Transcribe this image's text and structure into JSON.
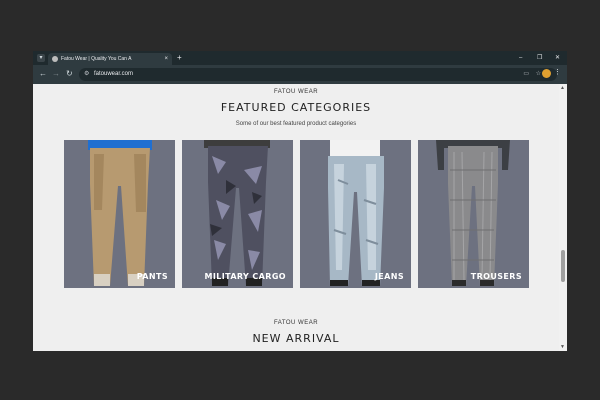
{
  "browser": {
    "tab_title": "Fatou Wear | Quality You Can A",
    "tab_close": "×",
    "new_tab": "+",
    "minimize": "–",
    "restore": "❐",
    "close": "✕",
    "back": "←",
    "forward": "→",
    "reload": "↻",
    "url": "fatouwear.com",
    "menu": "⋮"
  },
  "featured": {
    "eyebrow": "FATOU WEAR",
    "title": "FEATURED CATEGORIES",
    "subtitle": "Some of our best featured product categories",
    "categories": [
      {
        "label": "PANTS"
      },
      {
        "label": "MILITARY CARGO"
      },
      {
        "label": "JEANS"
      },
      {
        "label": "TROUSERS"
      }
    ]
  },
  "arrival": {
    "eyebrow": "FATOU WEAR",
    "title": "NEW ARRIVAL"
  },
  "colors": {
    "card_bg": "#6d7180",
    "page_bg": "#efefef",
    "chrome_dark": "#1f2a2e"
  }
}
